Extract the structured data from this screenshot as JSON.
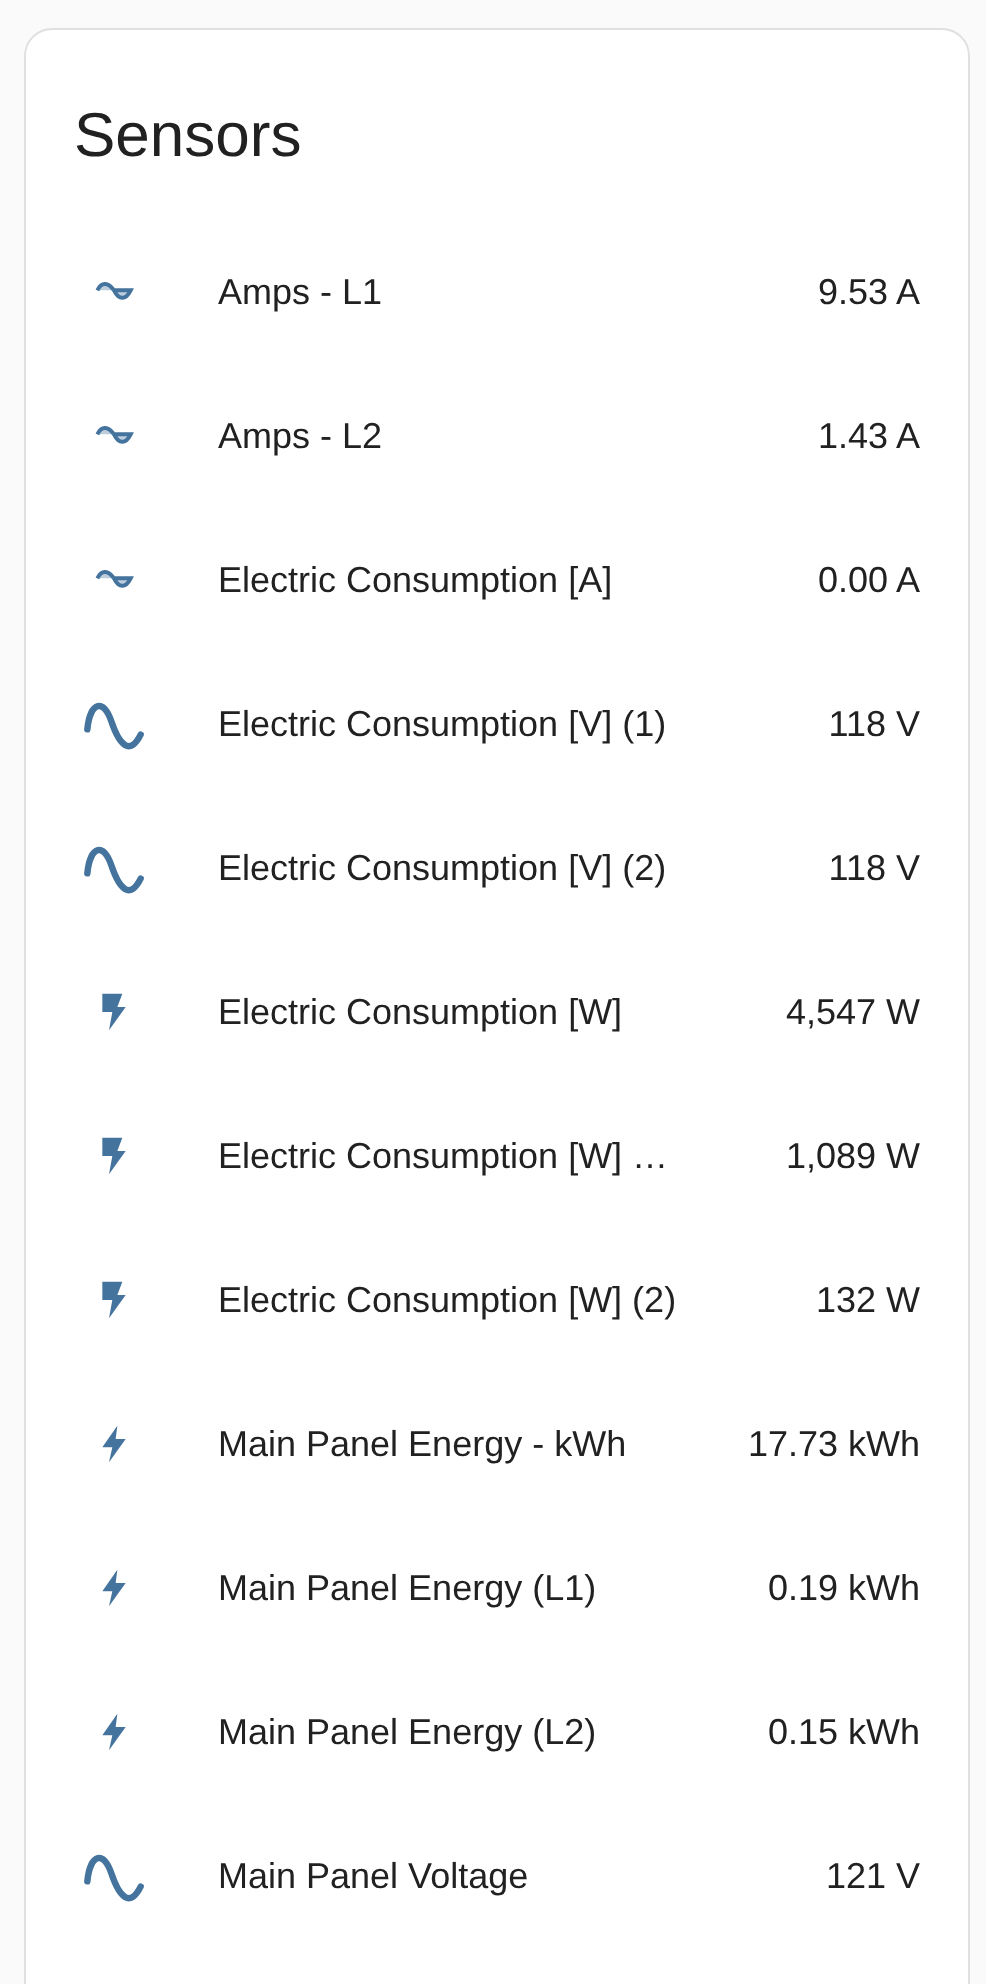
{
  "card": {
    "title": "Sensors",
    "rows": [
      {
        "kind": "current",
        "name": "Amps - L1",
        "value": "9.53 A"
      },
      {
        "kind": "current",
        "name": "Amps - L2",
        "value": "1.43 A"
      },
      {
        "kind": "current",
        "name": "Electric Consumption [A]",
        "value": "0.00 A"
      },
      {
        "kind": "voltage",
        "name": "Electric Consumption [V] (1)",
        "value": "118 V"
      },
      {
        "kind": "voltage",
        "name": "Electric Consumption [V] (2)",
        "value": "118 V"
      },
      {
        "kind": "power",
        "name": "Electric Consumption [W]",
        "value": "4,547 W"
      },
      {
        "kind": "power",
        "name": "Electric Consumption [W] …",
        "value": "1,089 W"
      },
      {
        "kind": "power",
        "name": "Electric Consumption [W] (2)",
        "value": "132 W"
      },
      {
        "kind": "energy",
        "name": "Main Panel Energy - kWh",
        "value": "17.73 kWh"
      },
      {
        "kind": "energy",
        "name": "Main Panel Energy (L1)",
        "value": "0.19 kWh"
      },
      {
        "kind": "energy",
        "name": "Main Panel Energy (L2)",
        "value": "0.15 kWh"
      },
      {
        "kind": "voltage",
        "name": "Main Panel Voltage",
        "value": "121 V"
      }
    ]
  }
}
